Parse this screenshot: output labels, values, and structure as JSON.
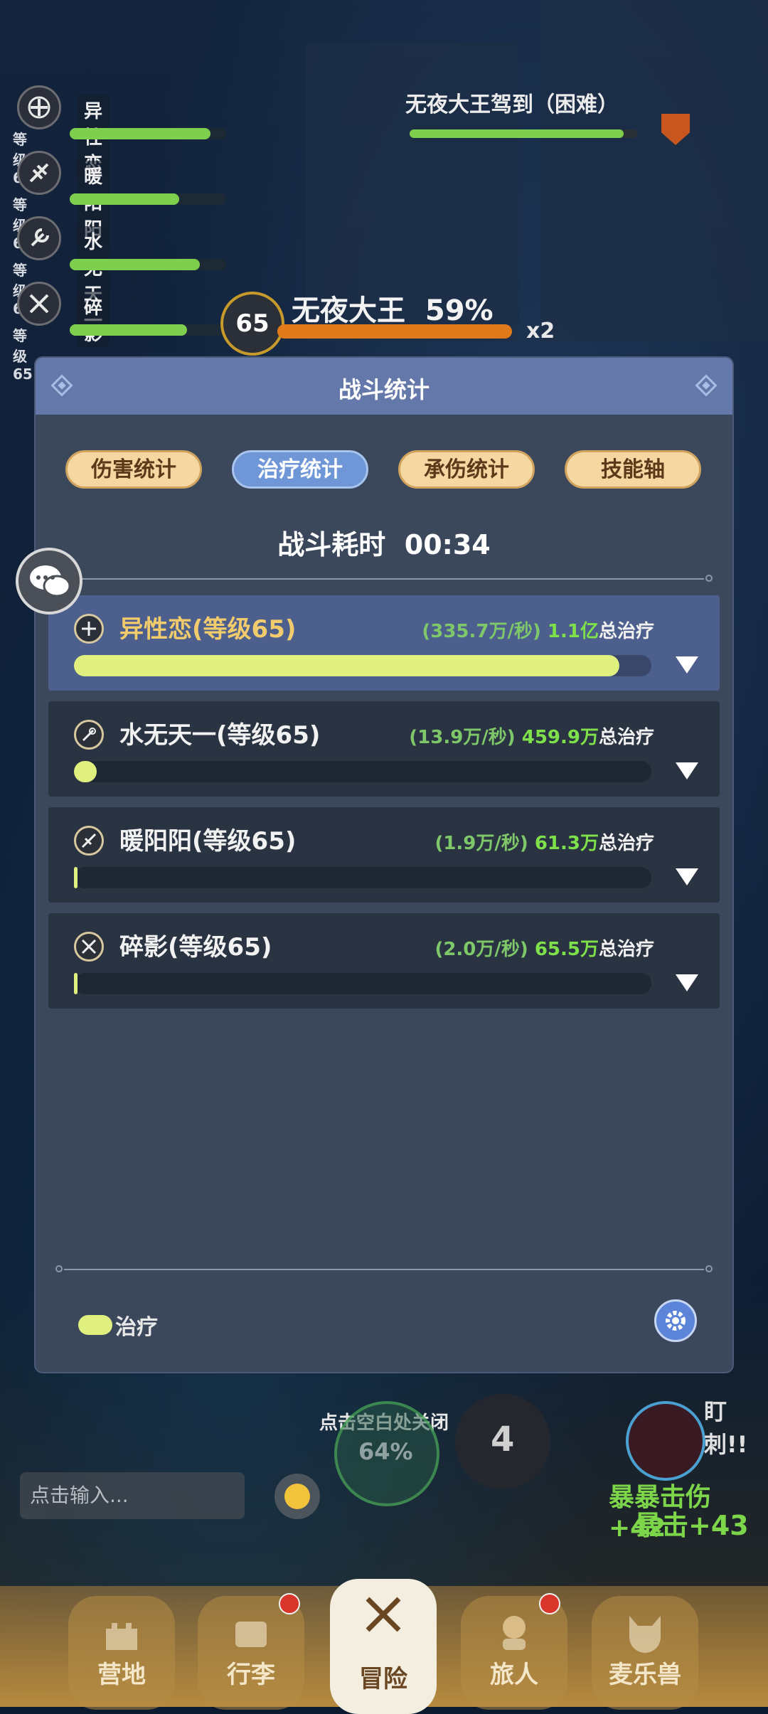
{
  "party": [
    {
      "name": "异性恋",
      "level": "等级65",
      "hp": 0.9,
      "icon": "cross-icon"
    },
    {
      "name": "暖阳阳",
      "level": "等级65",
      "hp": 0.7,
      "icon": "plane-icon"
    },
    {
      "name": "水无天一",
      "level": "等级65",
      "hp": 0.83,
      "icon": "wrench-icon"
    },
    {
      "name": "碎影",
      "level": "等级65",
      "hp": 0.75,
      "icon": "swords-icon"
    }
  ],
  "boss_top": {
    "title": "无夜大王驾到（困难）"
  },
  "boss": {
    "level": "65",
    "name": "无夜大王",
    "percent": "59%",
    "multiplier": "x2"
  },
  "dialog": {
    "title": "战斗统计",
    "tabs": [
      "伤害统计",
      "治疗统计",
      "承伤统计",
      "技能轴"
    ],
    "active_tab": 1,
    "duration_label": "战斗耗时",
    "duration_value": "00:34",
    "rows": [
      {
        "name": "异性恋(等级65)",
        "rate": "(335.7万/秒)",
        "total": "1.1亿",
        "total_label": "总治疗",
        "fraction": 0.945,
        "icon": "cross-icon"
      },
      {
        "name": "水无天一(等级65)",
        "rate": "(13.9万/秒)",
        "total": "459.9万",
        "total_label": "总治疗",
        "fraction": 0.04,
        "icon": "wrench-icon"
      },
      {
        "name": "暖阳阳(等级65)",
        "rate": "(1.9万/秒)",
        "total": "61.3万",
        "total_label": "总治疗",
        "fraction": 0.006,
        "icon": "plane-icon"
      },
      {
        "name": "碎影(等级65)",
        "rate": "(2.0万/秒)",
        "total": "65.5万",
        "total_label": "总治疗",
        "fraction": 0.006,
        "icon": "swords-icon"
      }
    ],
    "legend": "治疗"
  },
  "close_hint": "点击空白处关闭",
  "chat_input": {
    "placeholder": "点击输入..."
  },
  "skills": {
    "skill1_percent": "64%",
    "skill2_count": "4"
  },
  "combat_text": {
    "tag": "盯刺!!",
    "line1": "暴暴击伤+42",
    "line2": "暴击+43"
  },
  "nav": [
    {
      "label": "营地",
      "icon": "castle-icon",
      "badge": false
    },
    {
      "label": "行李",
      "icon": "chest-icon",
      "badge": true
    },
    {
      "label": "冒险",
      "icon": "crossed-swords-icon",
      "badge": false,
      "active": true
    },
    {
      "label": "旅人",
      "icon": "traveler-icon",
      "badge": true
    },
    {
      "label": "麦乐兽",
      "icon": "beast-icon",
      "badge": false
    }
  ],
  "colors": {
    "heal_bar": "#dff07f",
    "header": "#6478aa",
    "tab_active": "#6f97d8",
    "tab_inactive": "#f5d7a2",
    "highlight_row": "#4d5f8d"
  }
}
